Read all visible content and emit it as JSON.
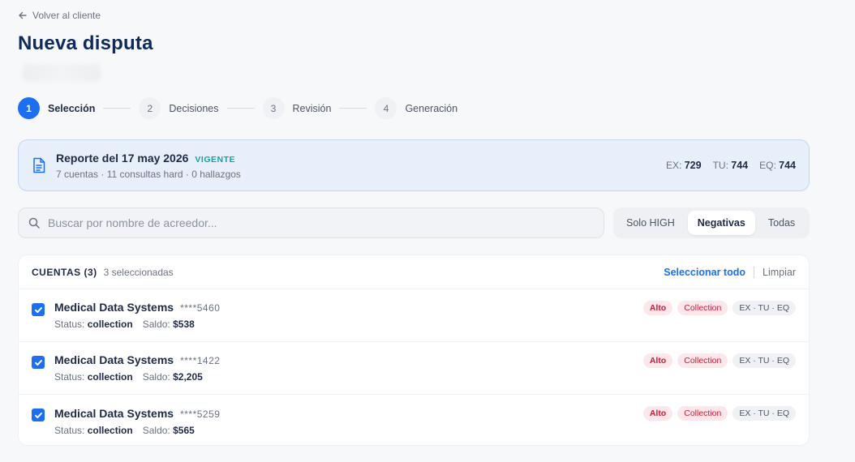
{
  "nav": {
    "back_label": "Volver al cliente"
  },
  "page": {
    "title": "Nueva disputa"
  },
  "steps": [
    {
      "num": "1",
      "label": "Selección",
      "active": true
    },
    {
      "num": "2",
      "label": "Decisiones",
      "active": false
    },
    {
      "num": "3",
      "label": "Revisión",
      "active": false
    },
    {
      "num": "4",
      "label": "Generación",
      "active": false
    }
  ],
  "report": {
    "title": "Reporte del 17 may 2026",
    "status": "VIGENTE",
    "meta": "7 cuentas · 11 consultas hard · 0 hallazgos",
    "scores": [
      {
        "label": "EX:",
        "value": "729"
      },
      {
        "label": "TU:",
        "value": "744"
      },
      {
        "label": "EQ:",
        "value": "744"
      }
    ]
  },
  "search": {
    "placeholder": "Buscar por nombre de acreedor...",
    "value": ""
  },
  "filters": [
    {
      "label": "Solo HIGH",
      "active": false
    },
    {
      "label": "Negativas",
      "active": true
    },
    {
      "label": "Todas",
      "active": false
    }
  ],
  "accounts": {
    "title": "CUENTAS (3)",
    "selected_text": "3 seleccionadas",
    "select_all_label": "Seleccionar todo",
    "clear_label": "Limpiar",
    "status_label": "Status:",
    "balance_label": "Saldo:",
    "items": [
      {
        "name": "Medical Data Systems",
        "number": "****5460",
        "status": "collection",
        "balance": "$538",
        "tags": [
          "Alto",
          "Collection",
          "EX · TU · EQ"
        ],
        "checked": true
      },
      {
        "name": "Medical Data Systems",
        "number": "****1422",
        "status": "collection",
        "balance": "$2,205",
        "tags": [
          "Alto",
          "Collection",
          "EX · TU · EQ"
        ],
        "checked": true
      },
      {
        "name": "Medical Data Systems",
        "number": "****5259",
        "status": "collection",
        "balance": "$565",
        "tags": [
          "Alto",
          "Collection",
          "EX · TU · EQ"
        ],
        "checked": true
      }
    ]
  },
  "colors": {
    "primary": "#1d6ff2",
    "title": "#0f2a5c",
    "vigente": "#1aa39a",
    "danger": "#c81e3a"
  }
}
